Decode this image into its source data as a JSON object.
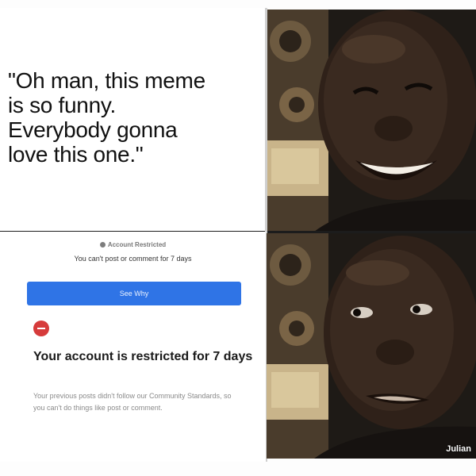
{
  "caption": {
    "line1": "\"Oh man, this meme",
    "line2": "is so funny.",
    "line3": "Everybody gonna",
    "line4": "love this one.\""
  },
  "notice": {
    "tag": "Account Restricted",
    "subtitle": "You can't post or comment for 7 days",
    "button_label": "See Why",
    "title": "Your account is restricted for 7 days",
    "description": "Your previous posts didn't follow our Community Standards, so you can't do things like post or comment."
  },
  "photos": {
    "top": {
      "expression": "smiling"
    },
    "bottom": {
      "expression": "disappointed"
    }
  },
  "watermark": "Julian",
  "colors": {
    "button": "#2f74e6",
    "warning": "#d63b3b",
    "skin": "#3a2a20",
    "background_wall": "#c9b48a"
  }
}
